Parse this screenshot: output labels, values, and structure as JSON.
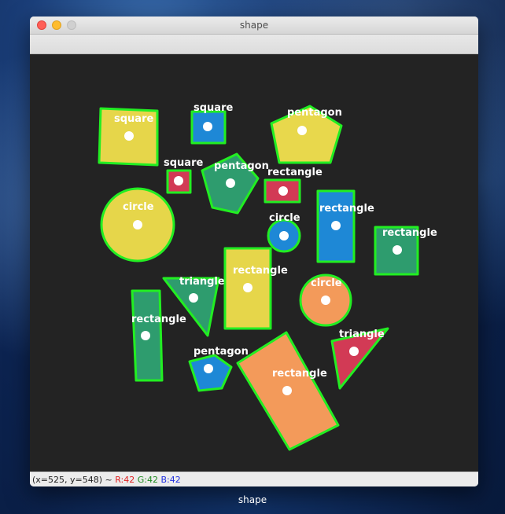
{
  "window": {
    "title": "shape"
  },
  "status": {
    "coords": "(x=525, y=548) ~ ",
    "r": "R:42",
    "g": "G:42",
    "b": "B:42"
  },
  "dock": {
    "label": "shape"
  },
  "shapes": [
    {
      "label": "square",
      "fill": "#e6d64a"
    },
    {
      "label": "square",
      "fill": "#1e88d6"
    },
    {
      "label": "pentagon",
      "fill": "#e8d84c"
    },
    {
      "label": "square",
      "fill": "#d23a55"
    },
    {
      "label": "pentagon",
      "fill": "#2e9c6e"
    },
    {
      "label": "rectangle",
      "fill": "#d23a55"
    },
    {
      "label": "circle",
      "fill": "#e6d64a"
    },
    {
      "label": "circle",
      "fill": "#1e88d6"
    },
    {
      "label": "rectangle",
      "fill": "#1e88d6"
    },
    {
      "label": "rectangle",
      "fill": "#2e9c6e"
    },
    {
      "label": "triangle",
      "fill": "#2e9c6e"
    },
    {
      "label": "rectangle",
      "fill": "#e6d64a"
    },
    {
      "label": "circle",
      "fill": "#f39a5a"
    },
    {
      "label": "rectangle",
      "fill": "#2e9c6e"
    },
    {
      "label": "triangle",
      "fill": "#d23a55"
    },
    {
      "label": "pentagon",
      "fill": "#1e88d6"
    },
    {
      "label": "rectangle",
      "fill": "#f39a5a"
    }
  ],
  "colors": {
    "contour": "#22ee22",
    "center_dot": "#ffffff"
  }
}
